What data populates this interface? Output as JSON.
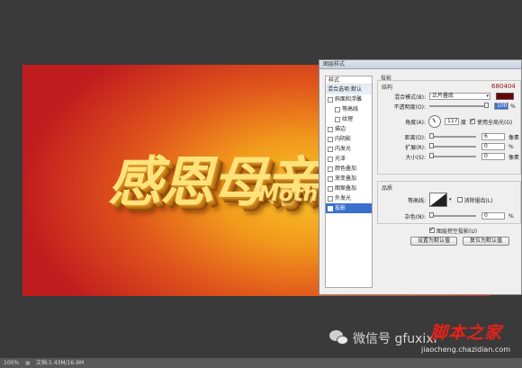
{
  "canvas": {
    "title_cn": "感恩母亲",
    "title_en": "Mothe"
  },
  "dialog": {
    "title": "图层样式",
    "styles_header": "样式",
    "styles": [
      {
        "label": "混合选项:默认",
        "checkbox": false,
        "indent": false,
        "selected": false,
        "blend": true
      },
      {
        "label": "斜面和浮雕",
        "checkbox": true,
        "indent": false,
        "selected": false
      },
      {
        "label": "等高线",
        "checkbox": true,
        "indent": true,
        "selected": false
      },
      {
        "label": "纹理",
        "checkbox": true,
        "indent": true,
        "selected": false
      },
      {
        "label": "描边",
        "checkbox": true,
        "indent": false,
        "selected": false
      },
      {
        "label": "内阴影",
        "checkbox": true,
        "indent": false,
        "selected": false
      },
      {
        "label": "内发光",
        "checkbox": true,
        "indent": false,
        "selected": false
      },
      {
        "label": "光泽",
        "checkbox": true,
        "indent": false,
        "selected": false
      },
      {
        "label": "颜色叠加",
        "checkbox": true,
        "indent": false,
        "selected": false
      },
      {
        "label": "渐变叠加",
        "checkbox": true,
        "indent": false,
        "selected": false
      },
      {
        "label": "图案叠加",
        "checkbox": true,
        "indent": false,
        "selected": false
      },
      {
        "label": "外发光",
        "checkbox": true,
        "indent": false,
        "selected": false
      },
      {
        "label": "投影",
        "checkbox": true,
        "indent": false,
        "selected": true
      }
    ],
    "section_title": "投影",
    "structure_title": "结构",
    "color_hex_text": "680404",
    "shadow_color": "#680404",
    "blend_mode_label": "混合模式(B):",
    "blend_mode_value": "正片叠底",
    "opacity_label": "不透明度(O):",
    "opacity_value": "100",
    "opacity_unit": "%",
    "angle_label": "角度(A):",
    "angle_value": "117",
    "angle_unit": "度",
    "global_light_label": "使用全局光(G)",
    "distance_label": "距离(D):",
    "distance_value": "6",
    "distance_unit": "像素",
    "spread_label": "扩展(R):",
    "spread_value": "0",
    "spread_unit": "%",
    "size_label": "大小(S):",
    "size_value": "0",
    "size_unit": "像素",
    "quality_title": "品质",
    "contour_label": "等高线:",
    "antialias_label": "消除锯齿(L)",
    "noise_label": "杂色(N):",
    "noise_value": "0",
    "noise_unit": "%",
    "knockout_label": "图层挖空投影(U)",
    "set_default_label": "设置为默认值",
    "reset_default_label": "复位为默认值"
  },
  "statusbar": {
    "zoom": "100%",
    "doc_info": "文档:1.43M/16.9M"
  },
  "watermark": {
    "wechat_text": "微信号 gfuxixi",
    "brand": "脚本之家",
    "url": "jiaocheng.chazidian.com"
  }
}
